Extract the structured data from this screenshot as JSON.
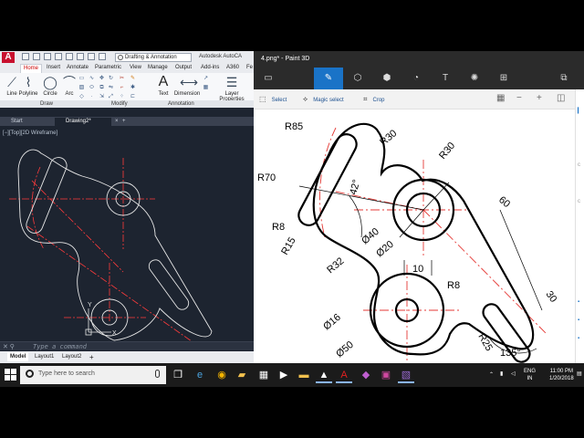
{
  "autocad": {
    "app_title": "Autodesk AutoCA",
    "workspace": "Drafting & Annotation",
    "ribbon_tabs": [
      "Home",
      "Insert",
      "Annotate",
      "Parametric",
      "View",
      "Manage",
      "Output",
      "Add-ins",
      "A360",
      "Fe"
    ],
    "tools": {
      "line": "Line",
      "polyline": "Polyline",
      "circle": "Circle",
      "arc": "Arc",
      "text": "Text",
      "dimension": "Dimension",
      "layer_properties_1": "Layer",
      "layer_properties_2": "Properties"
    },
    "panels": {
      "draw": "Draw",
      "modify": "Modify",
      "annotation": "Annotation"
    },
    "file_tabs": {
      "start": "Start",
      "drawing": "Drawing2*"
    },
    "viewport_label": "[−][Top][2D Wireframe]",
    "command_placeholder": "Type a command",
    "layout_tabs": [
      "Model",
      "Layout1",
      "Layout2"
    ]
  },
  "paint3d": {
    "title": "4.png* - Paint 3D",
    "subtools": {
      "select": "Select",
      "magic_select": "Magic select",
      "crop": "Crop"
    },
    "dims": {
      "r85": "R85",
      "r30a": "R30",
      "r30b": "R30",
      "r70": "R70",
      "angle42": "42°",
      "d60": "60",
      "r8a": "R8",
      "d40": "Ø40",
      "r15": "R15",
      "d20": "Ø20",
      "d10": "10",
      "r32": "R32",
      "d30": "30",
      "r8b": "R8",
      "d16": "Ø16",
      "r25": "R25",
      "d50": "Ø50",
      "angle135": "135°"
    }
  },
  "taskbar": {
    "search_placeholder": "Type here to search",
    "lang_1": "ENG",
    "lang_2": "IN",
    "time": "11:00 PM",
    "date": "1/20/2018"
  },
  "colors": {
    "acad_bg": "#1d2430",
    "paint_accent": "#1a73c7",
    "center_line": "#ff2a2a"
  }
}
